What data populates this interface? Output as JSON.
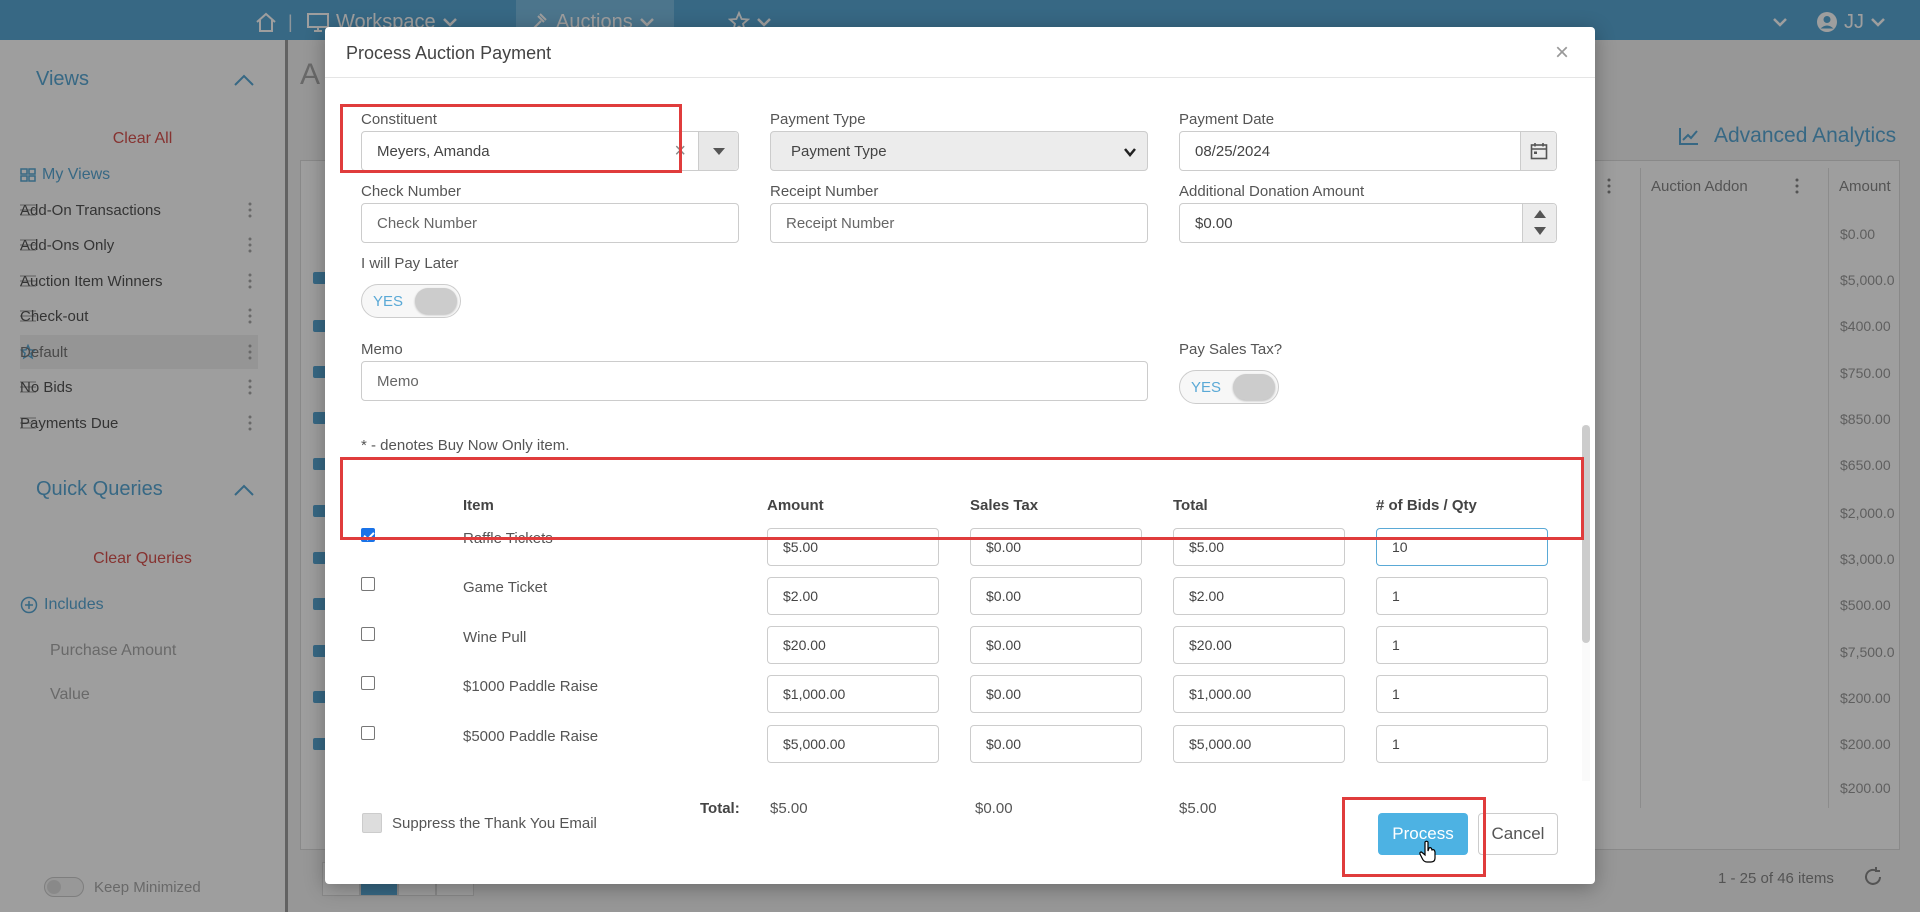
{
  "topnav": {
    "workspace_label": "Workspace",
    "auctions_label": "Auctions",
    "user_initials": "JJ",
    "bar_color": "#5aa9d6",
    "icons": [
      "home-icon",
      "monitor-icon",
      "gavel-icon",
      "star-icon",
      "chevron-down-icon",
      "user-circle-icon"
    ]
  },
  "sidebar": {
    "views_title": "Views",
    "clear_all": "Clear All",
    "my_views": "My Views",
    "views": [
      "Add-On Transactions",
      "Add-Ons Only",
      "Auction Item Winners",
      "Check-out",
      "Default",
      "No Bids",
      "Payments Due"
    ],
    "active_view": "Default",
    "quick_queries_title": "Quick Queries",
    "clear_queries": "Clear Queries",
    "includes": "Includes",
    "query_items": [
      "Purchase Amount",
      "Value"
    ],
    "keep_minimized": "Keep Minimized"
  },
  "background": {
    "page_initial": "A",
    "advanced_analytics": "Advanced Analytics",
    "column_headers": [
      "Auction Addon",
      "Amount"
    ],
    "amounts": [
      "$0.00",
      "$5,000.0",
      "$400.00",
      "$750.00",
      "$850.00",
      "$650.00",
      "$2,000.0",
      "$3,000.0",
      "$500.00",
      "$7,500.0",
      "$200.00",
      "$200.00",
      "$200.00"
    ],
    "pager_text": "1 - 25 of 46 items"
  },
  "modal": {
    "title": "Process Auction Payment",
    "close_glyph": "×",
    "constituent_label": "Constituent",
    "constituent_value": "Meyers, Amanda",
    "clear_glyph": "×",
    "payment_type_label": "Payment Type",
    "payment_type_value": "Payment Type",
    "payment_date_label": "Payment Date",
    "payment_date_value": "08/25/2024",
    "check_number_label": "Check Number",
    "check_number_placeholder": "Check Number",
    "receipt_number_label": "Receipt Number",
    "receipt_number_placeholder": "Receipt Number",
    "additional_donation_label": "Additional Donation Amount",
    "additional_donation_value": "$0.00",
    "pay_later_label": "I will Pay Later",
    "pay_later_toggle": "YES",
    "memo_label": "Memo",
    "memo_placeholder": "Memo",
    "sales_tax_label": "Pay Sales Tax?",
    "sales_tax_toggle": "YES",
    "buy_now_note": "* - denotes Buy Now Only item.",
    "columns": {
      "item": "Item",
      "amount": "Amount",
      "sales_tax": "Sales Tax",
      "total": "Total",
      "qty": "# of Bids / Qty"
    },
    "items": [
      {
        "checked": true,
        "name": "Raffle Tickets",
        "amount": "$5.00",
        "sales_tax": "$0.00",
        "total": "$5.00",
        "qty": "10"
      },
      {
        "checked": false,
        "name": "Game Ticket",
        "amount": "$2.00",
        "sales_tax": "$0.00",
        "total": "$2.00",
        "qty": "1"
      },
      {
        "checked": false,
        "name": "Wine Pull",
        "amount": "$20.00",
        "sales_tax": "$0.00",
        "total": "$20.00",
        "qty": "1"
      },
      {
        "checked": false,
        "name": "$1000 Paddle Raise",
        "amount": "$1,000.00",
        "sales_tax": "$0.00",
        "total": "$1,000.00",
        "qty": "1"
      },
      {
        "checked": false,
        "name": "$5000 Paddle Raise",
        "amount": "$5,000.00",
        "sales_tax": "$0.00",
        "total": "$5,000.00",
        "qty": "1"
      }
    ],
    "totals": {
      "label": "Total:",
      "amount": "$5.00",
      "sales_tax": "$0.00",
      "total": "$5.00"
    },
    "suppress_label": "Suppress the Thank You Email",
    "process_label": "Process",
    "cancel_label": "Cancel",
    "accent_color": "#4db2e3",
    "highlight_color": "#e03c3c"
  }
}
